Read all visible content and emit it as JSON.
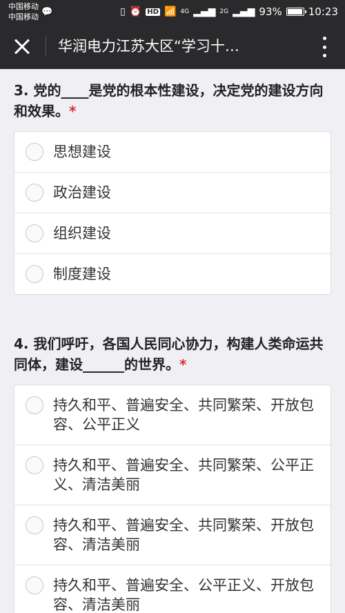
{
  "status_bar": {
    "carrier_1": "中国移动",
    "carrier_2": "中国移动",
    "network_4g": "4G",
    "network_2g": "2G",
    "battery": "93%",
    "time": "10:23",
    "hd_label": "HD"
  },
  "nav": {
    "title": "华润电力江苏大区“学习十…"
  },
  "questions": [
    {
      "title": "3. 党的____是党的根本性建设，决定党的建设方向和效果。",
      "required_mark": "*",
      "options": [
        "思想建设",
        "政治建设",
        "组织建设",
        "制度建设"
      ]
    },
    {
      "title": "4. 我们呼吁，各国人民同心协力，构建人类命运共同体，建设______的世界。",
      "required_mark": "*",
      "options": [
        "持久和平、普遍安全、共同繁荣、开放包容、公平正义",
        "持久和平、普遍安全、共同繁荣、公平正义、清洁美丽",
        "持久和平、普遍安全、共同繁荣、开放包容、清洁美丽",
        "持久和平、普遍安全、公平正义、开放包容、清洁美丽"
      ]
    }
  ]
}
